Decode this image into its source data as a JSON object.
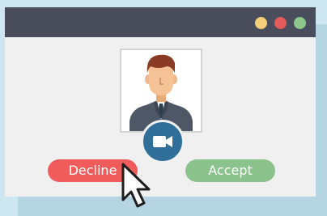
{
  "window": {
    "controls": [
      {
        "name": "minimize",
        "color": "#f3cf7a"
      },
      {
        "name": "close",
        "color": "#e35a5a"
      },
      {
        "name": "maximize",
        "color": "#8cc88b"
      }
    ]
  },
  "call": {
    "caller_avatar": "businessman-avatar",
    "video_icon": "video-camera-icon"
  },
  "actions": {
    "decline_label": "Decline",
    "decline_color": "#f05b5b",
    "accept_label": "Accept",
    "accept_color": "#8cc38d"
  },
  "cursor_icon": "mouse-pointer-icon"
}
